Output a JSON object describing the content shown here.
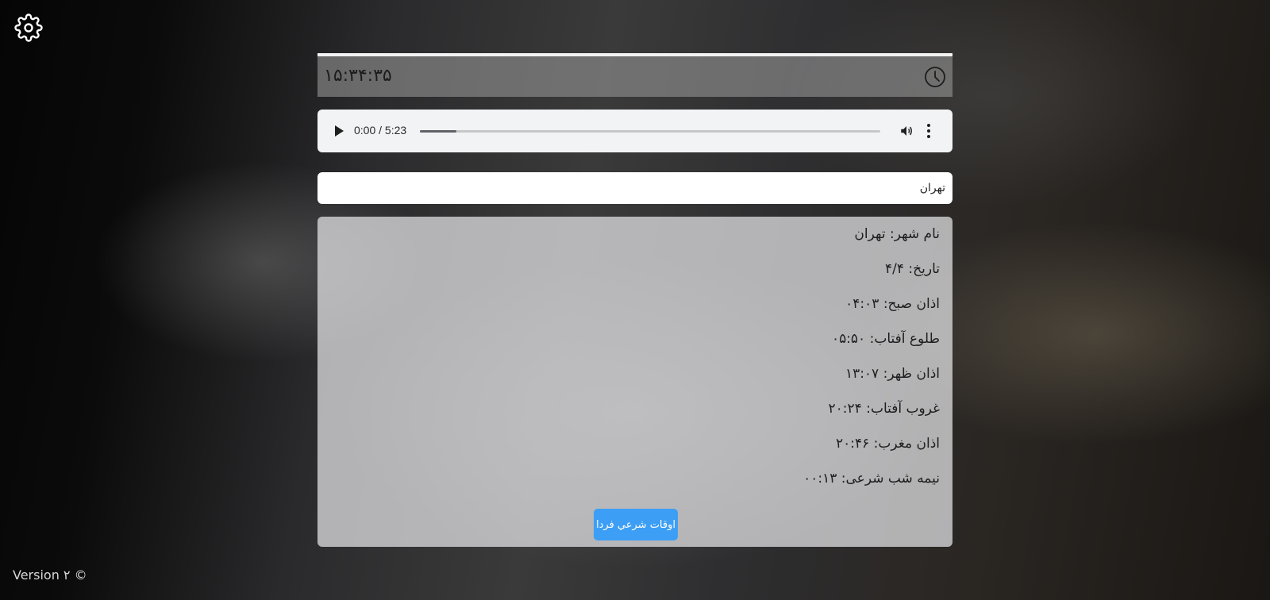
{
  "clock": {
    "time": "۱۵:۳۴:۳۵",
    "icon": "clock-icon"
  },
  "audio_player": {
    "time_display": "0:00 / 5:23",
    "buffered_fraction": 0.08,
    "controls": [
      "play-icon",
      "volume-icon",
      "more-menu-icon"
    ]
  },
  "city_input": {
    "value": "تهران"
  },
  "prayer_times": {
    "items": [
      {
        "label": "نام شهر: تهران"
      },
      {
        "label": "تاریخ: ۴/۴"
      },
      {
        "label": "اذان صبح: ۰۴:۰۳"
      },
      {
        "label": "طلوع آفتاب: ۰۵:۵۰"
      },
      {
        "label": "اذان ظهر: ۱۳:۰۷"
      },
      {
        "label": "غروب آفتاب: ۲۰:۲۴"
      },
      {
        "label": "اذان مغرب: ۲۰:۴۶"
      },
      {
        "label": "نیمه شب شرعی: ۰۰:۱۳"
      }
    ],
    "tomorrow_button": "اوقات شرعي فردا"
  },
  "footer": {
    "version": "Version ۲ ©"
  },
  "colors": {
    "button_bg": "#3d9ef5",
    "panel_bg": "#e8e8ea",
    "player_bg": "#f1f3f4"
  },
  "icons": {
    "settings": "gear-icon"
  }
}
